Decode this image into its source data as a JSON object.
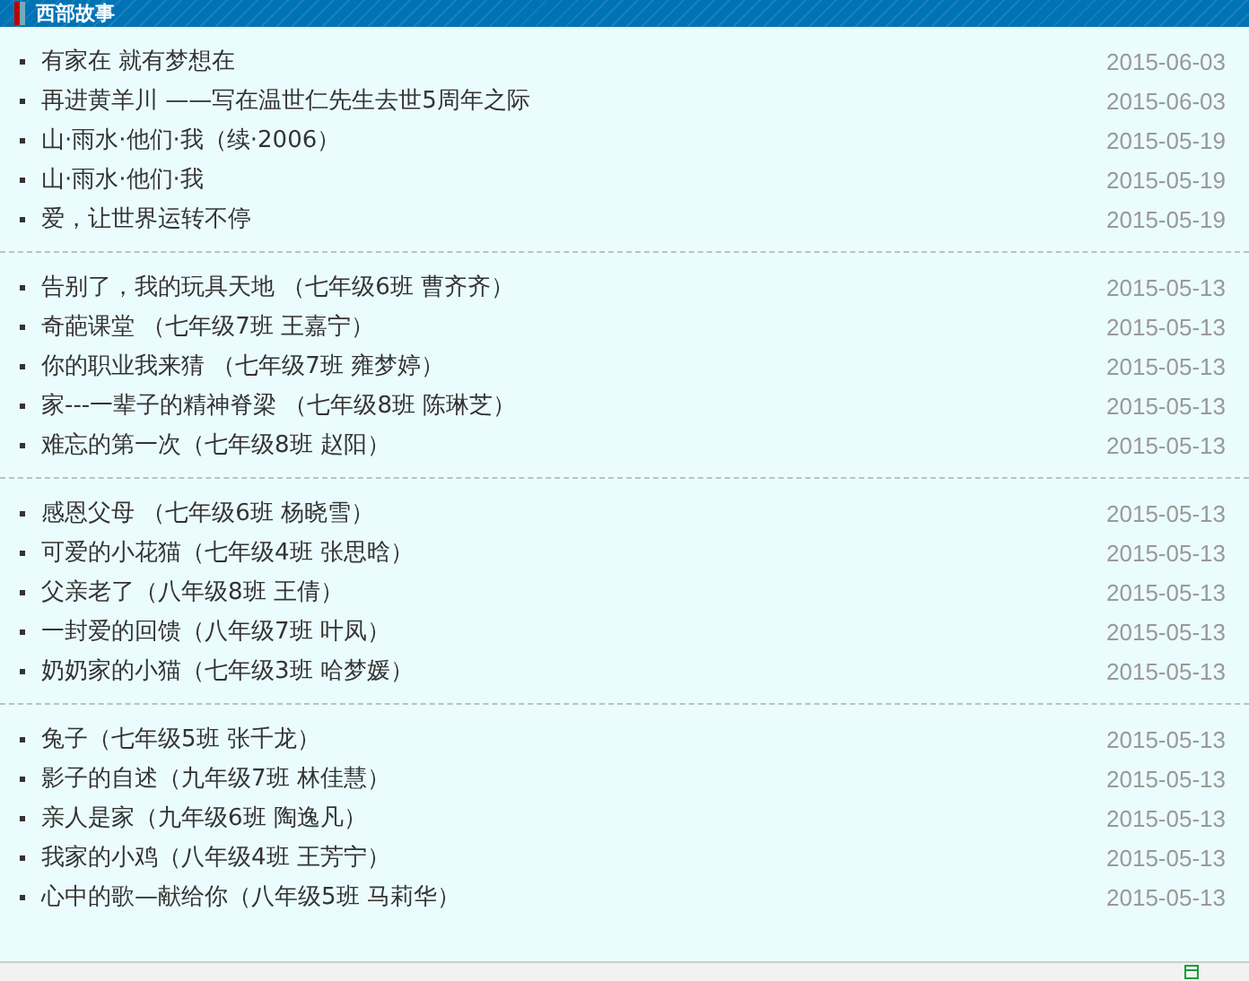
{
  "header": {
    "title": "西部故事"
  },
  "groups": [
    {
      "items": [
        {
          "title": "有家在 就有梦想在",
          "date": "2015-06-03"
        },
        {
          "title": "再进黄羊川 ——写在温世仁先生去世5周年之际",
          "date": "2015-06-03"
        },
        {
          "title": "山·雨水·他们·我（续·2006）",
          "date": "2015-05-19"
        },
        {
          "title": "山·雨水·他们·我",
          "date": "2015-05-19"
        },
        {
          "title": "爱，让世界运转不停",
          "date": "2015-05-19"
        }
      ]
    },
    {
      "items": [
        {
          "title": "告别了，我的玩具天地 （七年级6班 曹齐齐）",
          "date": "2015-05-13"
        },
        {
          "title": "奇葩课堂 （七年级7班 王嘉宁）",
          "date": "2015-05-13"
        },
        {
          "title": "你的职业我来猜 （七年级7班 雍梦婷）",
          "date": "2015-05-13"
        },
        {
          "title": "家---一辈子的精神脊梁 （七年级8班 陈琳芝）",
          "date": "2015-05-13"
        },
        {
          "title": "难忘的第一次（七年级8班 赵阳）",
          "date": "2015-05-13"
        }
      ]
    },
    {
      "items": [
        {
          "title": "感恩父母 （七年级6班 杨晓雪）",
          "date": "2015-05-13"
        },
        {
          "title": "可爱的小花猫（七年级4班 张思晗）",
          "date": "2015-05-13"
        },
        {
          "title": "父亲老了（八年级8班 王倩）",
          "date": "2015-05-13"
        },
        {
          "title": "一封爱的回馈（八年级7班 叶凤）",
          "date": "2015-05-13"
        },
        {
          "title": "奶奶家的小猫（七年级3班 哈梦媛）",
          "date": "2015-05-13"
        }
      ]
    },
    {
      "items": [
        {
          "title": "兔子（七年级5班 张千龙）",
          "date": "2015-05-13"
        },
        {
          "title": "影子的自述（九年级7班 林佳慧）",
          "date": "2015-05-13"
        },
        {
          "title": "亲人是家（九年级6班 陶逸凡）",
          "date": "2015-05-13"
        },
        {
          "title": "我家的小鸡（八年级4班 王芳宁）",
          "date": "2015-05-13"
        },
        {
          "title": "心中的歌—献给你（八年级5班 马莉华）",
          "date": "2015-05-13"
        }
      ]
    }
  ]
}
